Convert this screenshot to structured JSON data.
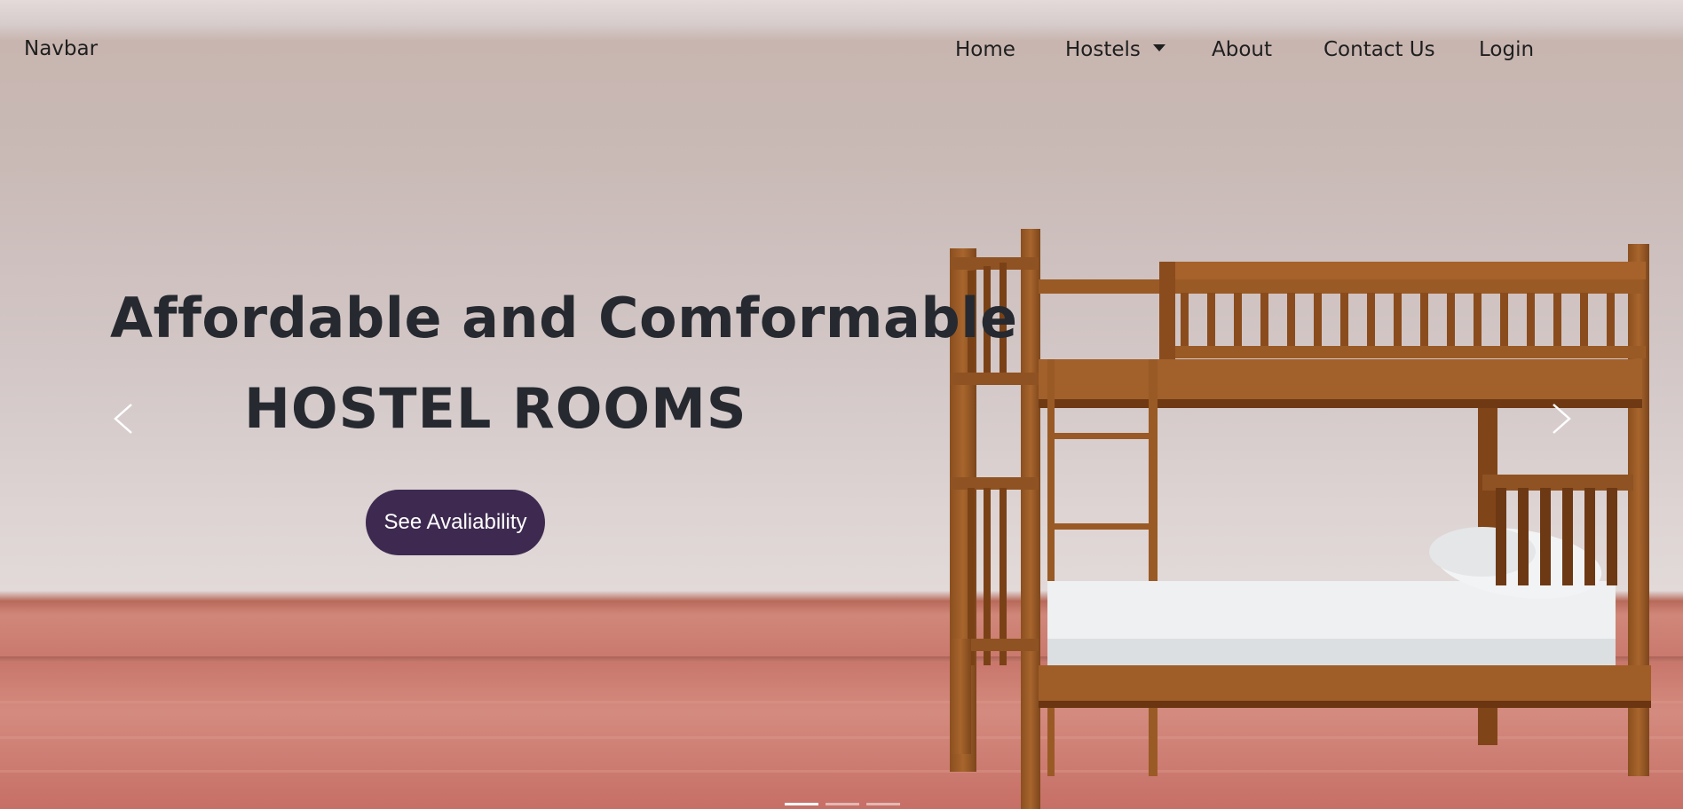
{
  "navbar": {
    "brand": "Navbar",
    "links": [
      {
        "label": "Home"
      },
      {
        "label": "Hostels",
        "dropdown": true
      },
      {
        "label": "About"
      },
      {
        "label": "Contact Us"
      },
      {
        "label": "Login"
      }
    ]
  },
  "carousel": {
    "headline_line1": "Affordable and Comformable",
    "headline_line2": "HOSTEL ROOMS",
    "cta_label": "See Avaliability",
    "slide_count": 3,
    "active_slide": 1,
    "image": "bunk-bed-icon"
  },
  "colors": {
    "accent": "#3e2a50",
    "text": "#262a30",
    "wood": "#9a5a25",
    "floor": "#c9776c"
  }
}
